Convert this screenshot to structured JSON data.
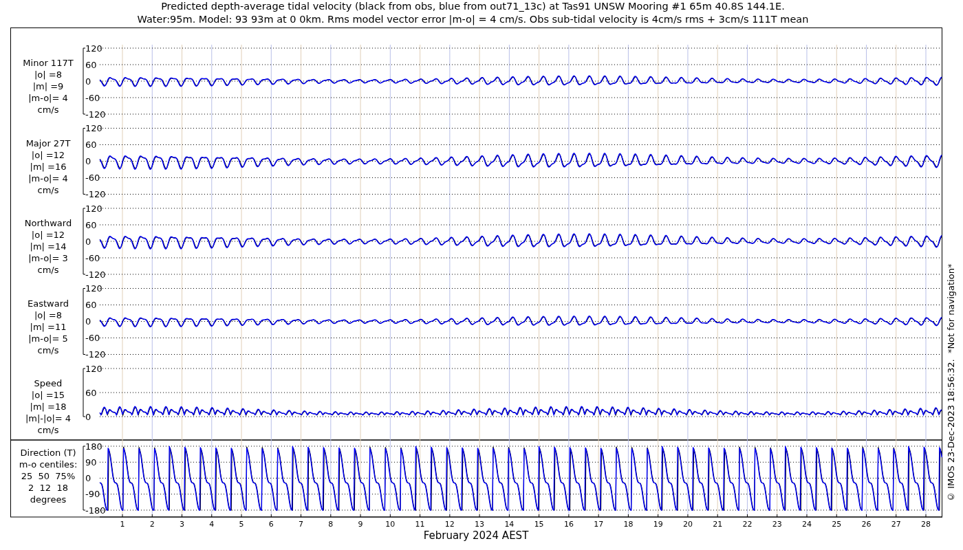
{
  "title": [
    "Predicted depth-average tidal velocity (black from obs, blue from out71_13c) at Tas91 UNSW Mooring #1 65m 40.8S 144.1E.",
    "Water:95m. Model: 93 93m at 0 0km. Rms model vector error |m-o| = 4 cm/s. Obs sub-tidal velocity is 4cm/s rms + 3cm/s 111T mean"
  ],
  "panels": [
    {
      "kind": "signed",
      "label_lines": [
        "Minor 117T",
        "|o| =8",
        "|m| =9",
        "|m-o|= 4",
        "cm/s"
      ],
      "yticks": [
        "120",
        "60",
        "0",
        "-60",
        "-120"
      ]
    },
    {
      "kind": "signed",
      "label_lines": [
        "Major 27T",
        "|o| =12",
        "|m| =16",
        "|m-o|= 4",
        "cm/s"
      ],
      "yticks": [
        "120",
        "60",
        "0",
        "-60",
        "-120"
      ]
    },
    {
      "kind": "signed",
      "label_lines": [
        "Northward",
        "|o| =12",
        "|m| =14",
        "|m-o|= 3",
        "cm/s"
      ],
      "yticks": [
        "120",
        "60",
        "0",
        "-60",
        "-120"
      ]
    },
    {
      "kind": "signed",
      "label_lines": [
        "Eastward",
        "|o| =8",
        "|m| =11",
        "|m-o|= 5",
        "cm/s"
      ],
      "yticks": [
        "120",
        "60",
        "0",
        "-60",
        "-120"
      ]
    },
    {
      "kind": "speed",
      "label_lines": [
        "Speed",
        "|o| =15",
        "|m| =18",
        "|m|-|o|= 4",
        "cm/s"
      ],
      "yticks": [
        "120",
        "60",
        "0"
      ]
    },
    {
      "kind": "direction",
      "label_lines": [
        "Direction (T)",
        "m-o centiles:",
        "25  50  75%",
        "2  12  18",
        "degrees"
      ],
      "yticks": [
        "180",
        "90",
        "0",
        "-90",
        "-180"
      ]
    }
  ],
  "xticks": [
    "1",
    "2",
    "3",
    "4",
    "5",
    "6",
    "7",
    "8",
    "9",
    "10",
    "11",
    "12",
    "13",
    "14",
    "15",
    "16",
    "17",
    "18",
    "19",
    "20",
    "21",
    "22",
    "23",
    "24",
    "25",
    "26",
    "27",
    "28"
  ],
  "xlabel": "February 2024 AEST",
  "credit": "© IMOS 23-Dec-2023 18:56:32.  *Not for navigation*"
}
